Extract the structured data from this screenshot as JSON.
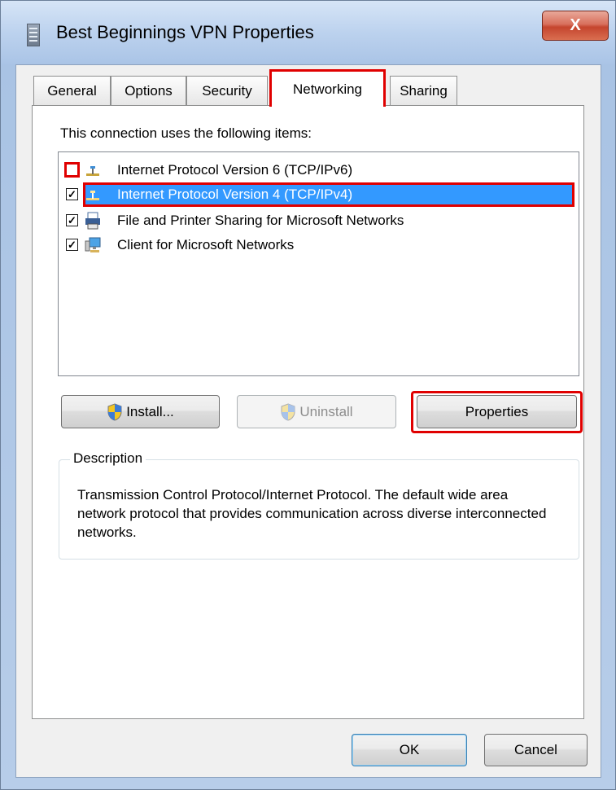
{
  "window": {
    "title": "Best Beginnings VPN Properties",
    "close_label": "X"
  },
  "tabs": [
    {
      "label": "General",
      "active": false
    },
    {
      "label": "Options",
      "active": false
    },
    {
      "label": "Security",
      "active": false
    },
    {
      "label": "Networking",
      "active": true
    },
    {
      "label": "Sharing",
      "active": false
    }
  ],
  "networking": {
    "items_label": "This connection uses the following items:",
    "items": [
      {
        "label": "Internet Protocol Version 6 (TCP/IPv6)",
        "checked": false,
        "icon": "network-protocol-icon"
      },
      {
        "label": "Internet Protocol Version 4 (TCP/IPv4)",
        "checked": true,
        "icon": "network-protocol-icon",
        "selected": true
      },
      {
        "label": "File and Printer Sharing for Microsoft Networks",
        "checked": true,
        "icon": "printer-sharing-icon"
      },
      {
        "label": "Client for Microsoft Networks",
        "checked": true,
        "icon": "network-client-icon"
      }
    ],
    "buttons": {
      "install": "Install...",
      "uninstall": "Uninstall",
      "properties": "Properties"
    },
    "description": {
      "legend": "Description",
      "text": "Transmission Control Protocol/Internet Protocol. The default wide area network protocol that provides communication across diverse interconnected networks."
    }
  },
  "footer": {
    "ok": "OK",
    "cancel": "Cancel"
  },
  "colors": {
    "selection": "#3399ff",
    "highlight": "#e00000"
  }
}
